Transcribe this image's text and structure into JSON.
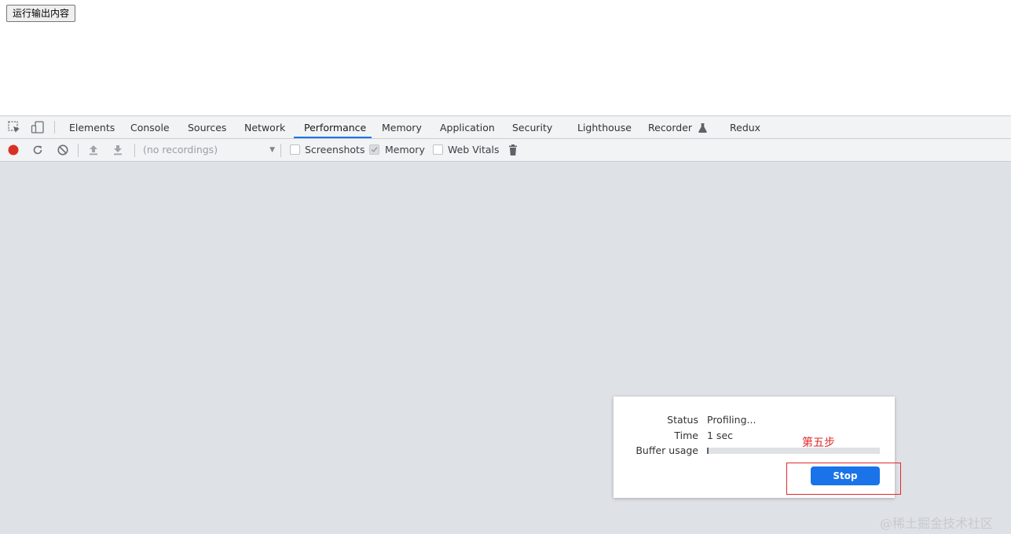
{
  "page": {
    "run_button_label": "运行输出内容"
  },
  "devtools": {
    "tabs": [
      {
        "label": "Elements"
      },
      {
        "label": "Console"
      },
      {
        "label": "Sources"
      },
      {
        "label": "Network"
      },
      {
        "label": "Performance",
        "active": true
      },
      {
        "label": "Memory"
      },
      {
        "label": "Application"
      },
      {
        "label": "Security"
      },
      {
        "label": "Lighthouse"
      },
      {
        "label": "Recorder"
      },
      {
        "label": "Redux"
      }
    ],
    "toolbar": {
      "recordings_placeholder": "(no recordings)",
      "checkboxes": [
        {
          "label": "Screenshots",
          "checked": false
        },
        {
          "label": "Memory",
          "checked": true
        },
        {
          "label": "Web Vitals",
          "checked": false
        }
      ]
    },
    "colors": {
      "record": "#d93025",
      "accent": "#1a73e8",
      "annotation": "#e0292b"
    }
  },
  "profiling_dialog": {
    "status_label": "Status",
    "status_value": "Profiling...",
    "time_label": "Time",
    "time_value": "1 sec",
    "buffer_label": "Buffer usage",
    "buffer_fraction": 0.01,
    "stop_label": "Stop"
  },
  "annotation": {
    "text": "第五步"
  },
  "watermark": "@稀土掘金技术社区"
}
